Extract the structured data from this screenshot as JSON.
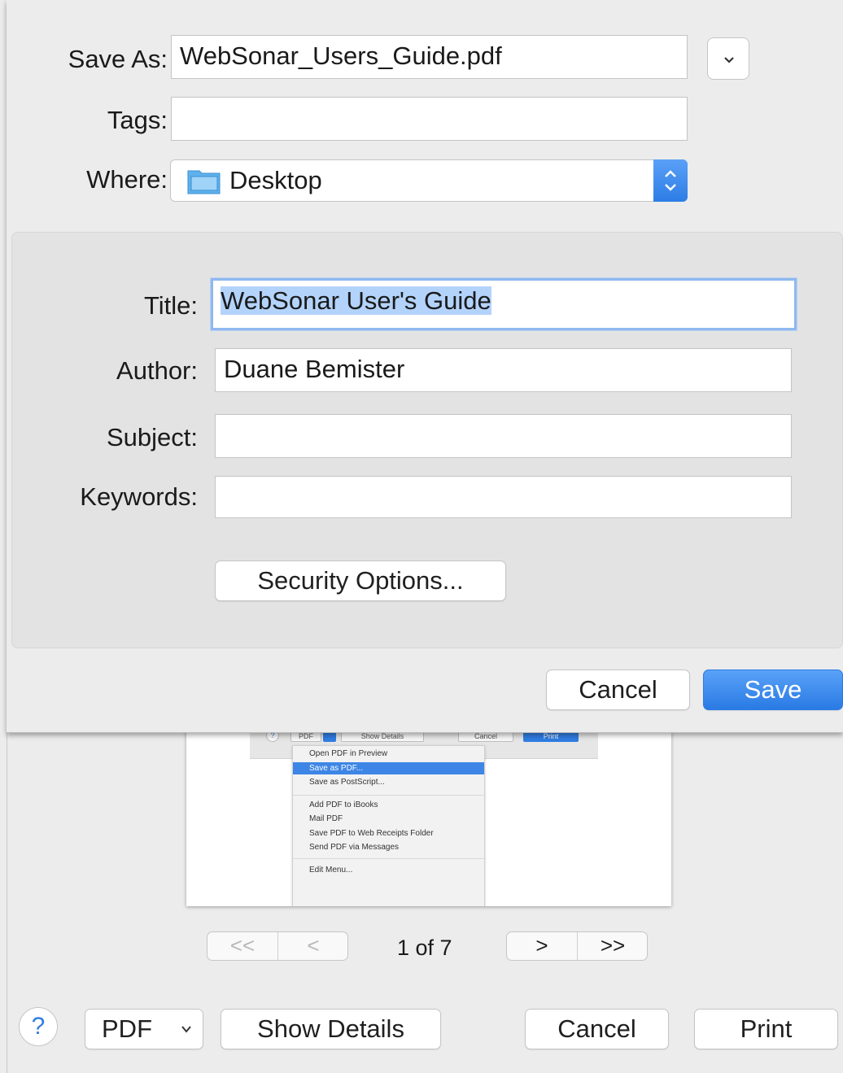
{
  "save_sheet": {
    "save_as_label": "Save As:",
    "save_as_value": "WebSonar_Users_Guide.pdf",
    "tags_label": "Tags:",
    "tags_value": "",
    "where_label": "Where:",
    "where_value": "Desktop",
    "details": {
      "title_label": "Title:",
      "title_value": "WebSonar User's Guide",
      "author_label": "Author:",
      "author_value": "Duane Bemister",
      "subject_label": "Subject:",
      "subject_value": "",
      "keywords_label": "Keywords:",
      "keywords_value": "",
      "security_button": "Security Options..."
    },
    "cancel_label": "Cancel",
    "save_label": "Save"
  },
  "preview": {
    "mini_buttons": [
      "PDF",
      "Show Details",
      "Cancel",
      "Print"
    ],
    "menu_items": [
      "Open PDF in Preview",
      "Save as PDF...",
      "Save as PostScript...",
      "Add PDF to iBooks",
      "Mail PDF",
      "Save PDF to Web Receipts Folder",
      "Send PDF via Messages",
      "Edit Menu..."
    ],
    "selected_item": "Save as PDF..."
  },
  "pager": {
    "first": "<<",
    "prev": "<",
    "page_text": "1 of 7",
    "next": ">",
    "last": ">>"
  },
  "print_bar": {
    "help": "?",
    "pdf_label": "PDF",
    "show_details": "Show Details",
    "cancel": "Cancel",
    "print": "Print"
  },
  "colors": {
    "accent": "#2f7de1",
    "focus_ring": "#8fb8ee",
    "selection": "#b3d3fb"
  }
}
